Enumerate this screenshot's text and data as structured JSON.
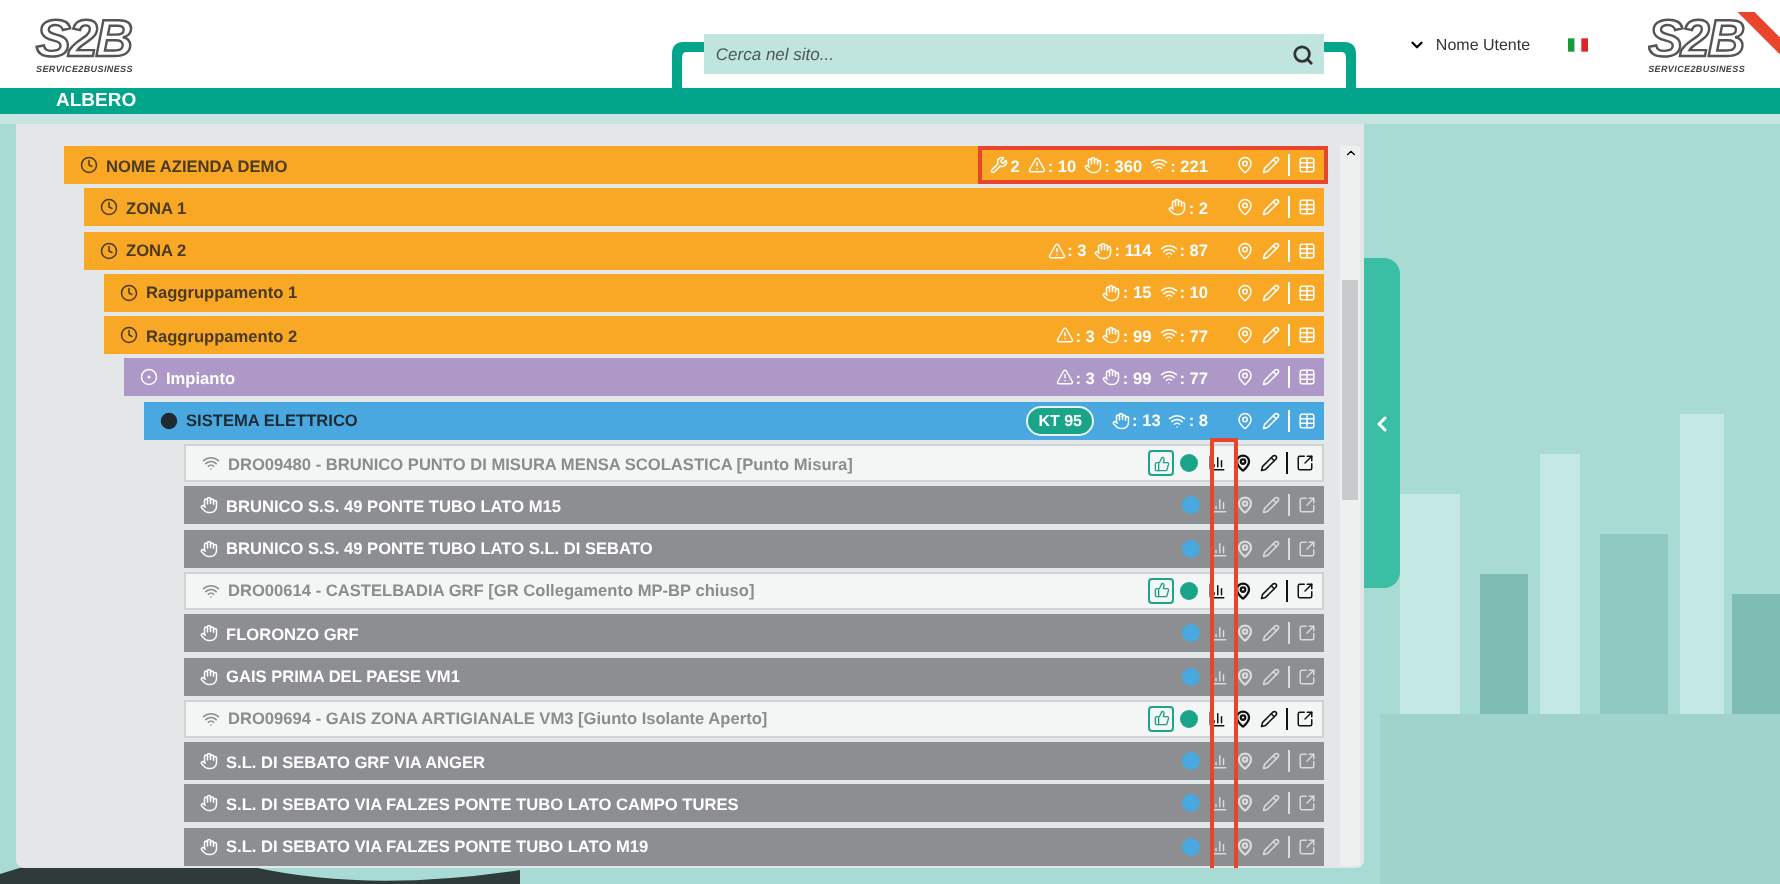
{
  "header": {
    "logo": {
      "mark": "S2B",
      "tagline": "SERVICE2BUSINESS"
    },
    "search": {
      "placeholder": "Cerca nel sito..."
    },
    "user": "Nome Utente",
    "brand": {
      "mark": "S2B",
      "tagline": "SERVICE2BUSINESS"
    }
  },
  "section_title": "ALBERO",
  "tree": {
    "kind": "company",
    "label": "NOME AZIENDA DEMO",
    "highlighted": true,
    "stats": [
      {
        "kind": "wrench",
        "text": "2"
      },
      {
        "kind": "warning",
        "text": ": 10"
      },
      {
        "kind": "hand",
        "text": ": 360"
      },
      {
        "kind": "wifi",
        "text": ": 221"
      }
    ],
    "children": [
      {
        "kind": "zone",
        "label": "ZONA 1",
        "highlighted": false,
        "stats": [
          {
            "kind": "hand",
            "text": ": 2"
          }
        ]
      },
      {
        "kind": "zone",
        "label": "ZONA 2",
        "highlighted": false,
        "stats": [
          {
            "kind": "warning",
            "text": ": 3"
          },
          {
            "kind": "hand",
            "text": ": 114"
          },
          {
            "kind": "wifi",
            "text": ": 87"
          }
        ],
        "children": [
          {
            "kind": "group",
            "label": "Raggruppamento 1",
            "highlighted": false,
            "stats": [
              {
                "kind": "hand",
                "text": ": 15"
              },
              {
                "kind": "wifi",
                "text": ": 10"
              }
            ]
          },
          {
            "kind": "group",
            "label": "Raggruppamento 2",
            "highlighted": false,
            "stats": [
              {
                "kind": "warning",
                "text": ": 3"
              },
              {
                "kind": "hand",
                "text": ": 99"
              },
              {
                "kind": "wifi",
                "text": ": 77"
              }
            ],
            "children": [
              {
                "kind": "plant",
                "label": "Impianto",
                "highlighted": false,
                "stats": [
                  {
                    "kind": "warning",
                    "text": ": 3"
                  },
                  {
                    "kind": "hand",
                    "text": ": 99"
                  },
                  {
                    "kind": "wifi",
                    "text": ": 77"
                  }
                ],
                "children": [
                  {
                    "kind": "system",
                    "label": "SISTEMA ELETTRICO",
                    "highlighted": false,
                    "badge": "KT 95",
                    "stats": [
                      {
                        "kind": "hand",
                        "text": ": 13"
                      },
                      {
                        "kind": "wifi",
                        "text": ": 8"
                      }
                    ],
                    "chart_column_highlighted": true,
                    "devices": [
                      {
                        "kind": "meter",
                        "label": "DRO09480 - BRUNICO PUNTO DI MISURA MENSA SCOLASTICA [Punto Misura]",
                        "approved": true,
                        "color": "#1aa58a"
                      },
                      {
                        "kind": "point",
                        "label": "BRUNICO S.S. 49 PONTE TUBO LATO M15",
                        "approved": false,
                        "color": "#4aa8e0"
                      },
                      {
                        "kind": "point",
                        "label": "BRUNICO S.S. 49 PONTE TUBO LATO S.L. DI SEBATO",
                        "approved": false,
                        "color": "#4aa8e0"
                      },
                      {
                        "kind": "meter",
                        "label": "DRO00614 - CASTELBADIA GRF [GR Collegamento MP-BP chiuso]",
                        "approved": true,
                        "color": "#1aa58a"
                      },
                      {
                        "kind": "point",
                        "label": "FLORONZO GRF",
                        "approved": false,
                        "color": "#4aa8e0"
                      },
                      {
                        "kind": "point",
                        "label": "GAIS PRIMA DEL PAESE VM1",
                        "approved": false,
                        "color": "#4aa8e0"
                      },
                      {
                        "kind": "meter",
                        "label": "DRO09694 - GAIS ZONA ARTIGIANALE VM3 [Giunto Isolante Aperto]",
                        "approved": true,
                        "color": "#1aa58a"
                      },
                      {
                        "kind": "point",
                        "label": "S.L. DI SEBATO GRF VIA ANGER",
                        "approved": false,
                        "color": "#4aa8e0"
                      },
                      {
                        "kind": "point",
                        "label": "S.L. DI SEBATO VIA FALZES PONTE TUBO LATO CAMPO TURES",
                        "approved": false,
                        "color": "#4aa8e0"
                      },
                      {
                        "kind": "point",
                        "label": "S.L. DI SEBATO VIA FALZES PONTE TUBO LATO M19",
                        "approved": false,
                        "color": "#4aa8e0"
                      }
                    ]
                  }
                ]
              }
            ]
          }
        ]
      }
    ]
  }
}
